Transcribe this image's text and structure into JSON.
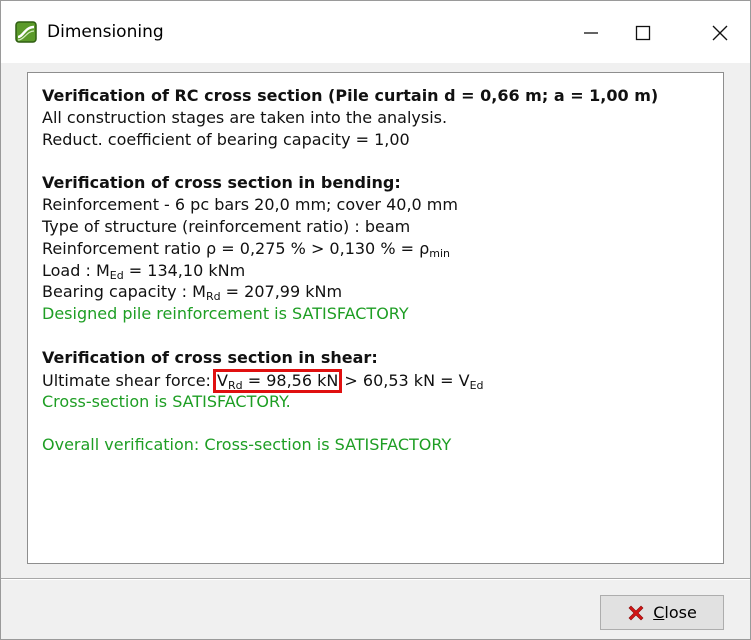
{
  "window": {
    "title": "Dimensioning",
    "minimize_glyph": "—",
    "maximize_glyph": "☐",
    "close_glyph": "✕",
    "icon": "app-logo-icon"
  },
  "report": {
    "section1_heading": "Verification of RC cross section (Pile curtain d = 0,66 m; a = 1,00 m)",
    "section1_lines": [
      "All construction stages are taken into the analysis.",
      "Reduct. coefficient of bearing capacity = 1,00"
    ],
    "bending_heading": "Verification of cross section in bending:",
    "bending_reinforcement": "Reinforcement - 6 pc bars 20,0 mm; cover 40,0 mm",
    "bending_structure_type": "Type of structure (reinforcement ratio) : beam",
    "ratio_text": "Reinforcement ratio ρ = 0,275 % > 0,130 % = ρ",
    "ratio_sub": "min",
    "load_prefix": "Load : M",
    "load_sub": "Ed",
    "load_suffix": " = 134,10 kNm",
    "capacity_prefix": "Bearing capacity : M",
    "capacity_sub": "Rd",
    "capacity_suffix": " = 207,99 kNm",
    "bending_result": "Designed pile reinforcement is SATISFACTORY",
    "shear_heading": "Verification of cross section in shear:",
    "shear_prefix": "Ultimate shear force: ",
    "shear_hl_v": "V",
    "shear_hl_sub": "Rd",
    "shear_hl_value": " = 98,56 kN",
    "shear_suffix": " > 60,53 kN = V",
    "shear_suffix_sub": "Ed",
    "shear_result": "Cross-section is SATISFACTORY.",
    "overall_result": "Overall verification: Cross-section is SATISFACTORY"
  },
  "footer": {
    "close_label_first": "C",
    "close_label_rest": "lose",
    "close_icon": "red-x-icon"
  },
  "colors": {
    "satisfactory_green": "#1e9e24",
    "highlight_red": "#e01010",
    "close_icon_red": "#d21414"
  }
}
